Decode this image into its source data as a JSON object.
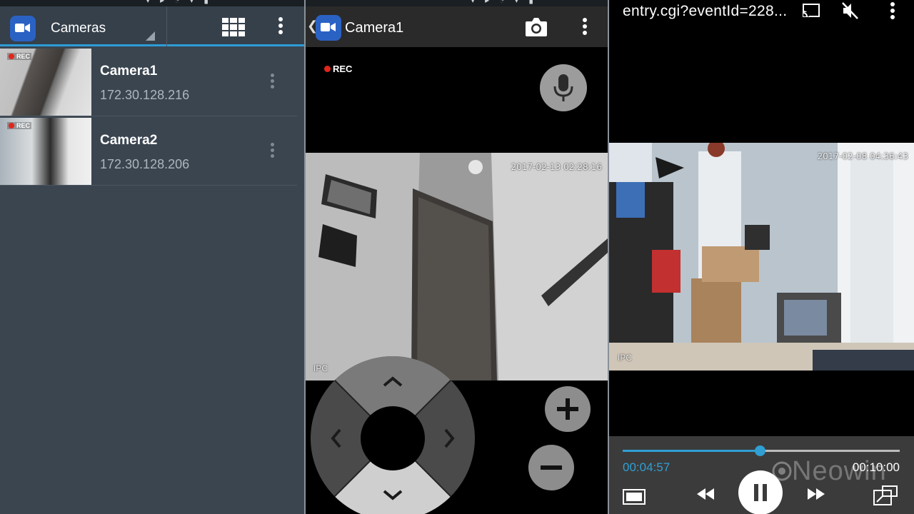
{
  "panel_list": {
    "title": "Cameras",
    "cameras": [
      {
        "name": "Camera1",
        "ip": "172.30.128.216",
        "rec": "REC"
      },
      {
        "name": "Camera2",
        "ip": "172.30.128.206",
        "rec": "REC"
      }
    ]
  },
  "panel_live": {
    "title": "Camera1",
    "rec": "REC",
    "timestamp": "2017-02-13 02:28:16",
    "source_label": "IPC"
  },
  "panel_playback": {
    "url": "entry.cgi?eventId=228...",
    "timestamp": "2017-02-08 04:36:43",
    "source_label": "IPC",
    "current_time": "00:04:57",
    "duration": "00:10:00",
    "progress_fraction": 0.495,
    "watermark": "Neowin"
  },
  "colors": {
    "accent": "#2e9bd6",
    "app_icon": "#2a62c4",
    "rec_red": "#e3251b",
    "list_bg": "#3a4550",
    "player_blue": "#2f9fd4"
  },
  "icons": [
    "video-camera-icon",
    "grid-view-icon",
    "more-vert-icon",
    "camera-snapshot-icon",
    "microphone-icon",
    "cast-icon",
    "volume-mute-icon",
    "rewind-icon",
    "pause-icon",
    "fast-forward-icon",
    "popup-window-icon",
    "fullscreen-icon",
    "zoom-in-icon",
    "zoom-out-icon"
  ]
}
